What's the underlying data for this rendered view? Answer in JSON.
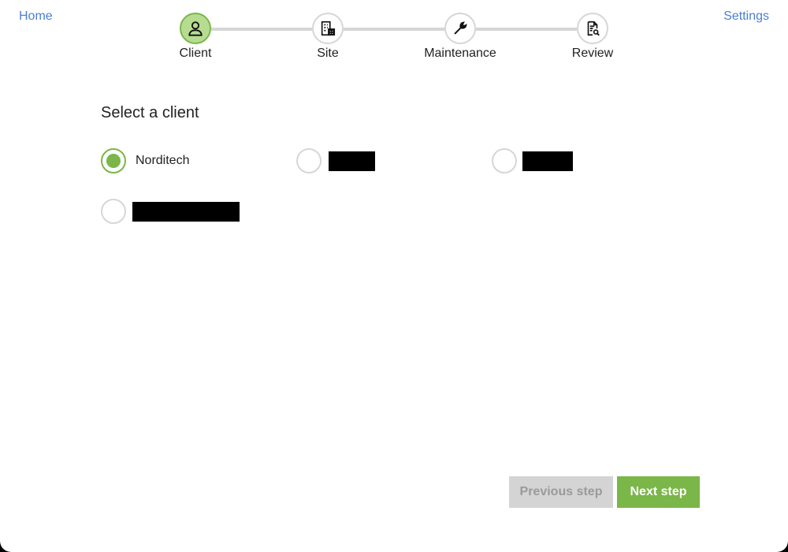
{
  "nav": {
    "home_label": "Home",
    "settings_label": "Settings"
  },
  "stepper": {
    "steps": [
      {
        "label": "Client",
        "icon": "user-icon",
        "active": true
      },
      {
        "label": "Site",
        "icon": "building-icon",
        "active": false
      },
      {
        "label": "Maintenance",
        "icon": "wrench-icon",
        "active": false
      },
      {
        "label": "Review",
        "icon": "document-search-icon",
        "active": false
      }
    ]
  },
  "main": {
    "title": "Select a client",
    "options": [
      {
        "label": "Norditech",
        "selected": true,
        "redacted": false
      },
      {
        "label": "",
        "selected": false,
        "redacted": true
      },
      {
        "label": "",
        "selected": false,
        "redacted": true
      },
      {
        "label": "",
        "selected": false,
        "redacted": true
      }
    ]
  },
  "footer": {
    "previous_label": "Previous step",
    "next_label": "Next step"
  },
  "colors": {
    "accent": "#7ab648",
    "accent_light": "#b6dc92",
    "link": "#4a7fd6",
    "inactive": "#d6d6d6"
  }
}
